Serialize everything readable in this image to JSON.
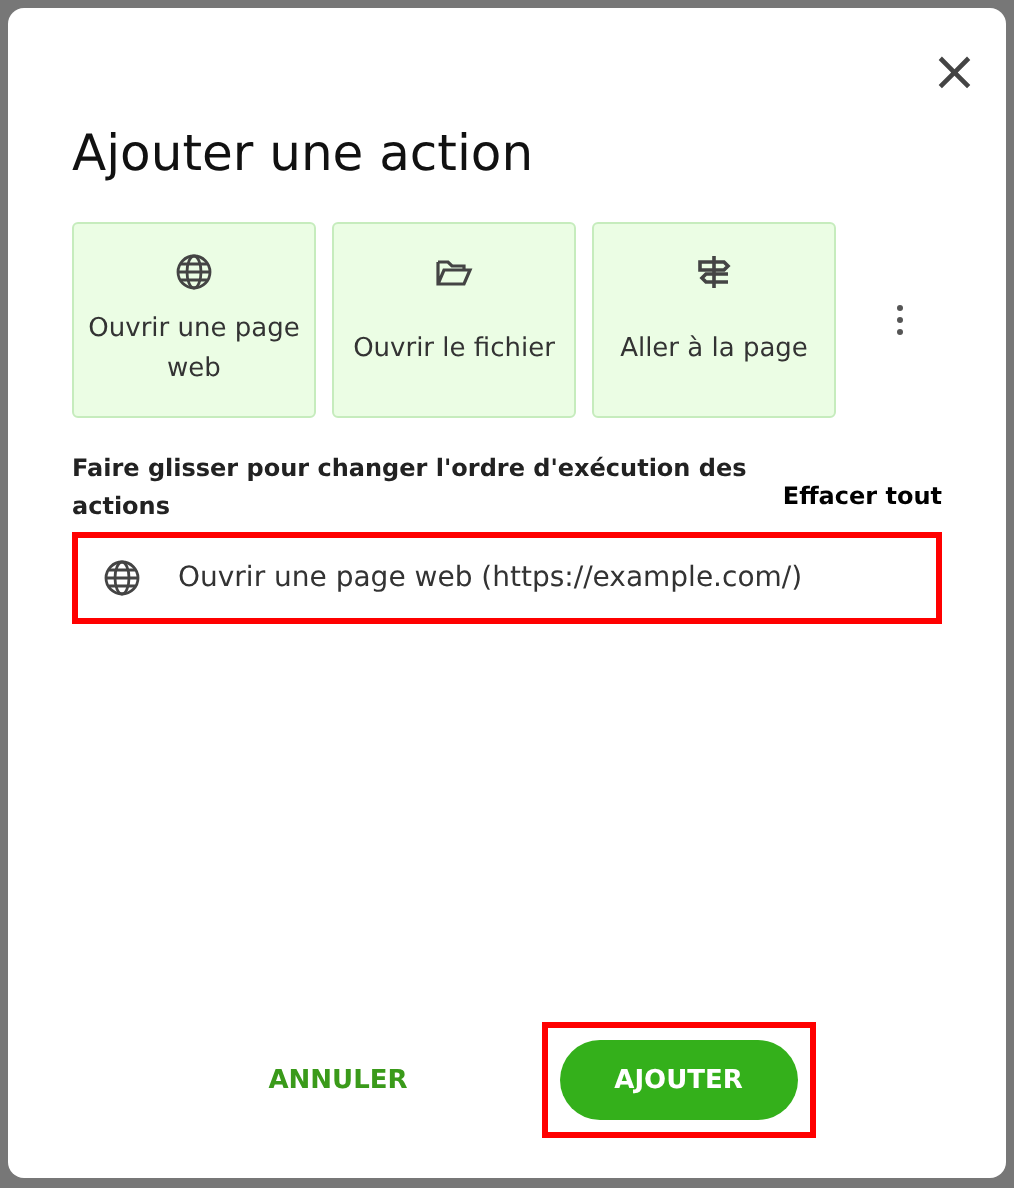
{
  "dialog": {
    "title": "Ajouter une action",
    "close": "×"
  },
  "action_types": [
    {
      "label": "Ouvrir une page web",
      "kind": "web"
    },
    {
      "label": "Ouvrir le fichier",
      "kind": "file"
    },
    {
      "label": "Aller à la page",
      "kind": "goto"
    }
  ],
  "instruction": "Faire glisser pour changer l'ordre d'exécution des actions",
  "clear_all": "Effacer tout",
  "actions": [
    {
      "label": "Ouvrir une page web (https://example.com/)",
      "kind": "web",
      "highlighted": true
    }
  ],
  "buttons": [
    {
      "label": "ANNULER",
      "kind": "text",
      "highlighted": false
    },
    {
      "label": "AJOUTER",
      "kind": "primary",
      "highlighted": true
    }
  ]
}
